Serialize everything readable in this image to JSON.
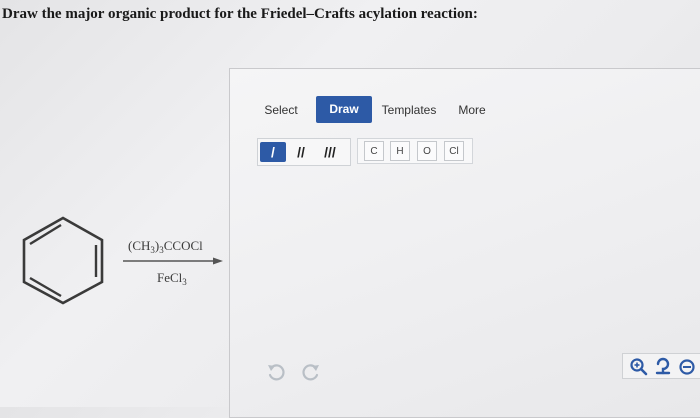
{
  "question": {
    "text": "Draw the major organic product for the Friedel–Crafts acylation reaction:"
  },
  "reaction": {
    "reagent_top": {
      "a": "(CH",
      "b": "3",
      "c": ")",
      "d": "3",
      "e": "CCOCl"
    },
    "reagent_bottom": {
      "a": "FeCl",
      "b": "3"
    }
  },
  "editor": {
    "tabs": {
      "select": "Select",
      "draw": "Draw",
      "templates": "Templates",
      "more": "More"
    },
    "bonds": {
      "single": "/",
      "double": "//",
      "triple": "///"
    },
    "atoms": {
      "c": "C",
      "h": "H",
      "o": "O",
      "cl": "Cl"
    },
    "icons": {
      "undo": "undo-icon",
      "redo": "redo-icon",
      "zoom_in": "zoom-in-icon",
      "zoom_fit": "zoom-fit-icon",
      "zoom_out": "zoom-out-icon"
    },
    "colors": {
      "accent": "#2d5aa6"
    }
  }
}
